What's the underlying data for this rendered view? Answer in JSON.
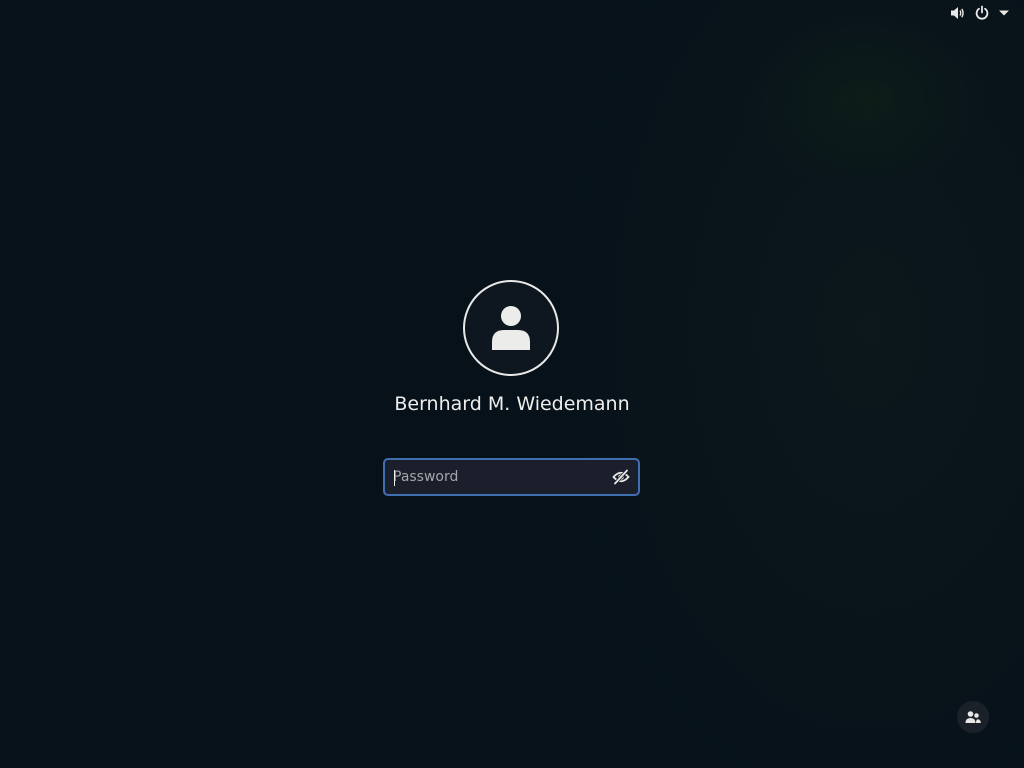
{
  "topbar": {
    "icons": [
      "volume-icon",
      "power-icon",
      "dropdown-arrow-icon"
    ]
  },
  "login": {
    "user_name": "Bernhard M. Wiedemann",
    "password": {
      "placeholder": "Password",
      "value": ""
    },
    "avatar_icon": "user-avatar-icon",
    "reveal_icon": "eye-slash-icon",
    "switch_user_icon": "switch-user-icon"
  },
  "colors": {
    "background": "#06111a",
    "accent": "#3f6fb0",
    "foreground": "#eeeeec"
  }
}
